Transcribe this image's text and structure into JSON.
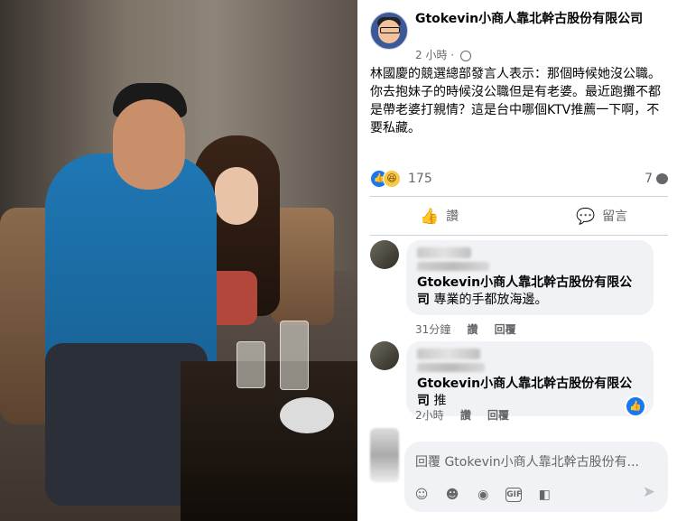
{
  "post": {
    "author": "Gtokevin小商人靠北幹古股份有限公司",
    "time": "2 小時",
    "text": "林國慶的競選總部發言人表示：那個時候她沒公職。你去抱妹子的時候沒公職但是有老婆。最近跑攤不都是帶老婆打親情？這是台中哪個KTV推薦一下啊，不要私藏。",
    "reaction_count": "175",
    "comment_count": "7"
  },
  "actions": {
    "like_label": "讚",
    "comment_label": "留言"
  },
  "comments": [
    {
      "author": "Gtokevin小商人靠北幹古股份有限公司",
      "text": "專業的手都放海邊。",
      "time": "31分鐘",
      "like_label": "讚",
      "reply_label": "回覆"
    },
    {
      "author": "Gtokevin小商人靠北幹古股份有限公司",
      "text": "推",
      "time": "2小時",
      "like_label": "讚",
      "reply_label": "回覆"
    }
  ],
  "reply_box": {
    "placeholder": "回覆 Gtokevin小商人靠北幹古股份有..."
  },
  "icons": {
    "like": "thumbs-up-icon",
    "comment": "comment-icon",
    "globe": "globe-icon",
    "send": "send-icon"
  },
  "colors": {
    "accent": "#1877f2",
    "secondary_text": "#65676b",
    "bubble_bg": "#f0f2f5"
  }
}
